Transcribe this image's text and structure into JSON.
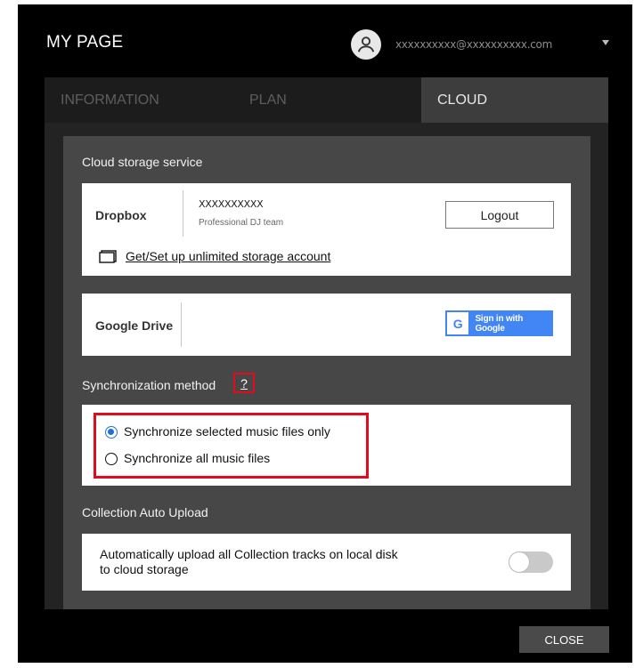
{
  "title": "MY PAGE",
  "account": {
    "email": "xxxxxxxxxx@xxxxxxxxxx.com"
  },
  "tabs": [
    {
      "label": "INFORMATION",
      "active": false
    },
    {
      "label": "PLAN",
      "active": false
    },
    {
      "label": "CLOUD",
      "active": true
    }
  ],
  "cloud_storage": {
    "heading": "Cloud storage service",
    "dropbox": {
      "name": "Dropbox",
      "user": "XXXXXXXXXX",
      "team": "Professional DJ team",
      "logout_label": "Logout",
      "unlimited_link": "Get/Set up unlimited storage account"
    },
    "google_drive": {
      "name": "Google Drive",
      "signin_label": "Sign in with Google"
    }
  },
  "sync": {
    "heading": "Synchronization method",
    "help_label": "?",
    "options": [
      {
        "label": "Synchronize selected music files only",
        "selected": true
      },
      {
        "label": "Synchronize all music files",
        "selected": false
      }
    ]
  },
  "auto_upload": {
    "heading": "Collection Auto Upload",
    "description_line1": "Automatically upload all Collection tracks on local disk",
    "description_line2": "to cloud storage",
    "enabled": false
  },
  "close_label": "CLOSE",
  "colors": {
    "accent": "#1f73d0",
    "highlight": "#e00c1c",
    "google_blue": "#4285f4"
  }
}
